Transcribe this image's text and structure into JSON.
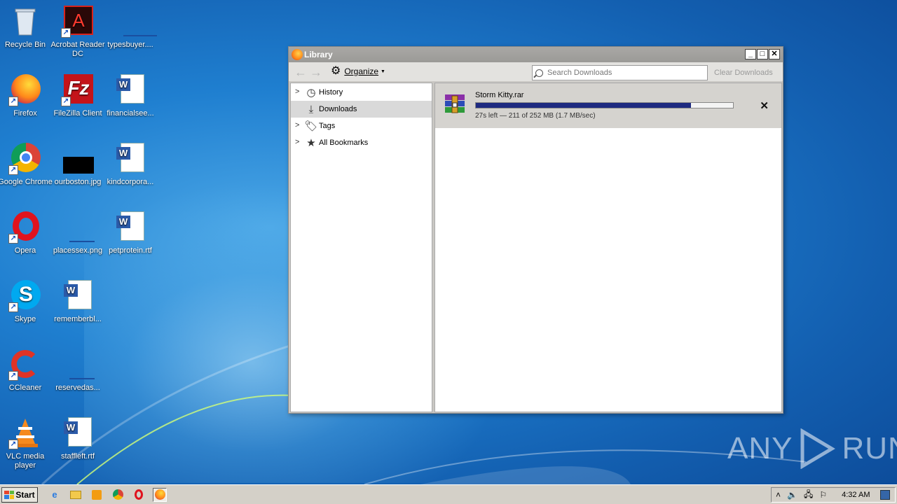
{
  "desktop": {
    "icons": [
      {
        "label": "Recycle Bin"
      },
      {
        "label": "Acrobat Reader DC"
      },
      {
        "label": "typesbuyer...."
      },
      {
        "label": "Firefox"
      },
      {
        "label": "FileZilla Client"
      },
      {
        "label": "financialsee..."
      },
      {
        "label": "Google Chrome"
      },
      {
        "label": "ourboston.jpg"
      },
      {
        "label": "kindcorpora..."
      },
      {
        "label": "Opera"
      },
      {
        "label": "placessex.png"
      },
      {
        "label": "petprotein.rtf"
      },
      {
        "label": "Skype"
      },
      {
        "label": "rememberbl..."
      },
      {
        "label": "CCleaner"
      },
      {
        "label": "reservedas..."
      },
      {
        "label": "VLC media player"
      },
      {
        "label": "staffleft.rtf"
      }
    ]
  },
  "window": {
    "title": "Library",
    "toolbar": {
      "organize_label": "Organize",
      "search_placeholder": "Search Downloads",
      "clear_label": "Clear Downloads"
    },
    "sidebar": {
      "items": [
        {
          "label": "History",
          "icon": "clock-icon",
          "expandable": true
        },
        {
          "label": "Downloads",
          "icon": "download-icon",
          "expandable": false,
          "selected": true
        },
        {
          "label": "Tags",
          "icon": "tag-icon",
          "expandable": true
        },
        {
          "label": "All Bookmarks",
          "icon": "star-icon",
          "expandable": true
        }
      ]
    },
    "downloads": [
      {
        "name": "Storm Kitty.rar",
        "status": "27s left — 211 of 252 MB (1.7 MB/sec)",
        "progress": 0.837
      }
    ]
  },
  "watermark": {
    "text_left": "ANY",
    "text_right": "RUN"
  },
  "taskbar": {
    "start_label": "Start",
    "clock": "4:32 AM"
  }
}
